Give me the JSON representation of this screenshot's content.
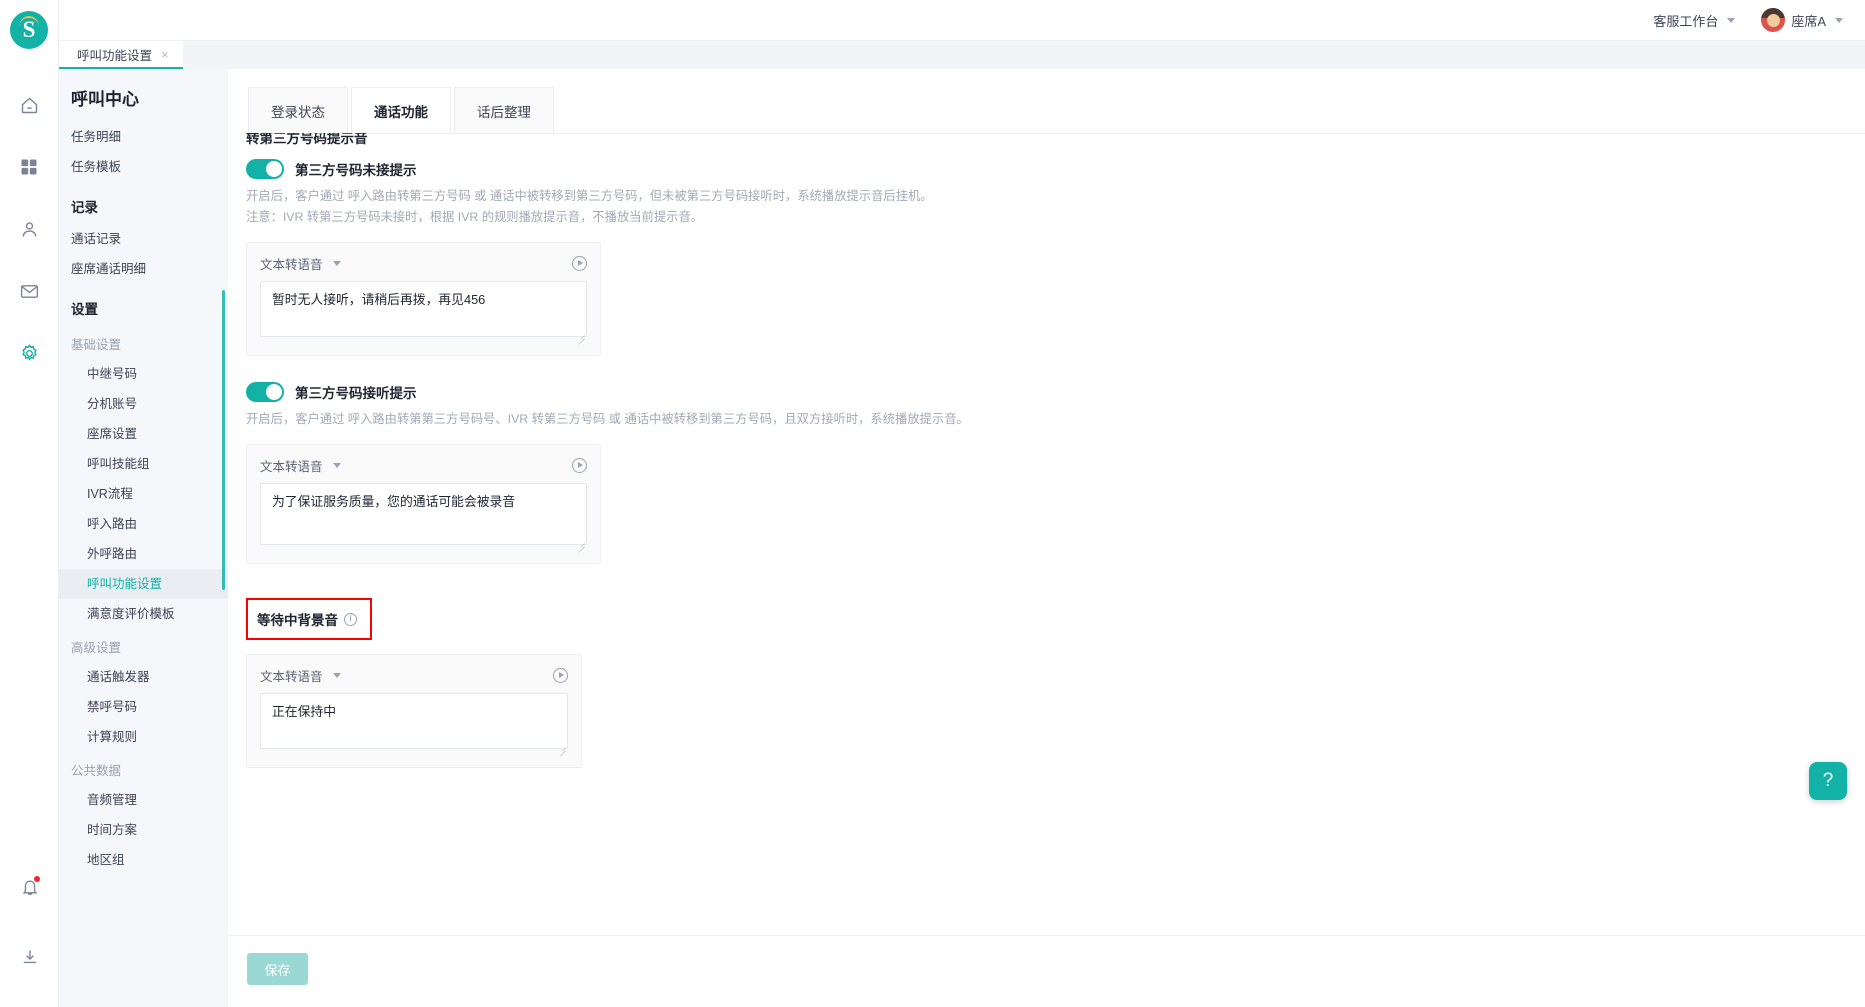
{
  "brand": {
    "logo_letter": "S",
    "accent": "#12b2a6"
  },
  "topbar": {
    "workbench_label": "客服工作台",
    "user_label": "座席A"
  },
  "page_tab": {
    "label": "呼叫功能设置",
    "close": "×"
  },
  "sidebar": {
    "title": "呼叫中心",
    "items": [
      {
        "label": "任务明细",
        "type": "item"
      },
      {
        "label": "任务模板",
        "type": "item"
      },
      {
        "label": "记录",
        "type": "group"
      },
      {
        "label": "通话记录",
        "type": "item"
      },
      {
        "label": "座席通话明细",
        "type": "item"
      },
      {
        "label": "设置",
        "type": "group"
      },
      {
        "label": "基础设置",
        "type": "sub"
      },
      {
        "label": "中继号码",
        "type": "child"
      },
      {
        "label": "分机账号",
        "type": "child"
      },
      {
        "label": "座席设置",
        "type": "child"
      },
      {
        "label": "呼叫技能组",
        "type": "child"
      },
      {
        "label": "IVR流程",
        "type": "child"
      },
      {
        "label": "呼入路由",
        "type": "child"
      },
      {
        "label": "外呼路由",
        "type": "child"
      },
      {
        "label": "呼叫功能设置",
        "type": "child",
        "active": true
      },
      {
        "label": "满意度评价模板",
        "type": "child"
      },
      {
        "label": "高级设置",
        "type": "sub"
      },
      {
        "label": "通话触发器",
        "type": "child"
      },
      {
        "label": "禁呼号码",
        "type": "child"
      },
      {
        "label": "计算规则",
        "type": "child"
      },
      {
        "label": "公共数据",
        "type": "sub"
      },
      {
        "label": "音频管理",
        "type": "child"
      },
      {
        "label": "时间方案",
        "type": "child"
      },
      {
        "label": "地区组",
        "type": "child"
      }
    ]
  },
  "main": {
    "tabs": [
      {
        "label": "登录状态",
        "active": false
      },
      {
        "label": "通话功能",
        "active": true
      },
      {
        "label": "话后整理",
        "active": false
      }
    ],
    "clipped_section_label": "转第三方号码提示音",
    "sections": [
      {
        "switch_on": true,
        "title": "第三方号码未接提示",
        "hint_line1": "开启后，客户通过 呼入路由转第三方号码 或 通话中被转移到第三方号码，但未被第三方号码接听时，系统播放提示音后挂机。",
        "hint_line2": "注意：IVR 转第三方号码未接时，根据 IVR 的规则播放提示音，不播放当前提示音。",
        "tts_mode": "文本转语音",
        "tts_text": "暂时无人接听，请稍后再拨，再见456"
      },
      {
        "switch_on": true,
        "title": "第三方号码接听提示",
        "hint_line1": "开启后，客户通过 呼入路由转第第三方号码号、IVR 转第三方号码 或 通话中被转移到第三方号码，且双方接听时，系统播放提示音。",
        "hint_line2": "",
        "tts_mode": "文本转语音",
        "tts_text": "为了保证服务质量，您的通话可能会被录音"
      }
    ],
    "background_block": {
      "label": "等待中背景音",
      "info_glyph": "i",
      "tts_mode": "文本转语音",
      "tts_text": "正在保持中",
      "highlight_color": "#fb0000"
    }
  },
  "footer": {
    "save_label": "保存"
  },
  "fab": {
    "glyph": "?"
  }
}
